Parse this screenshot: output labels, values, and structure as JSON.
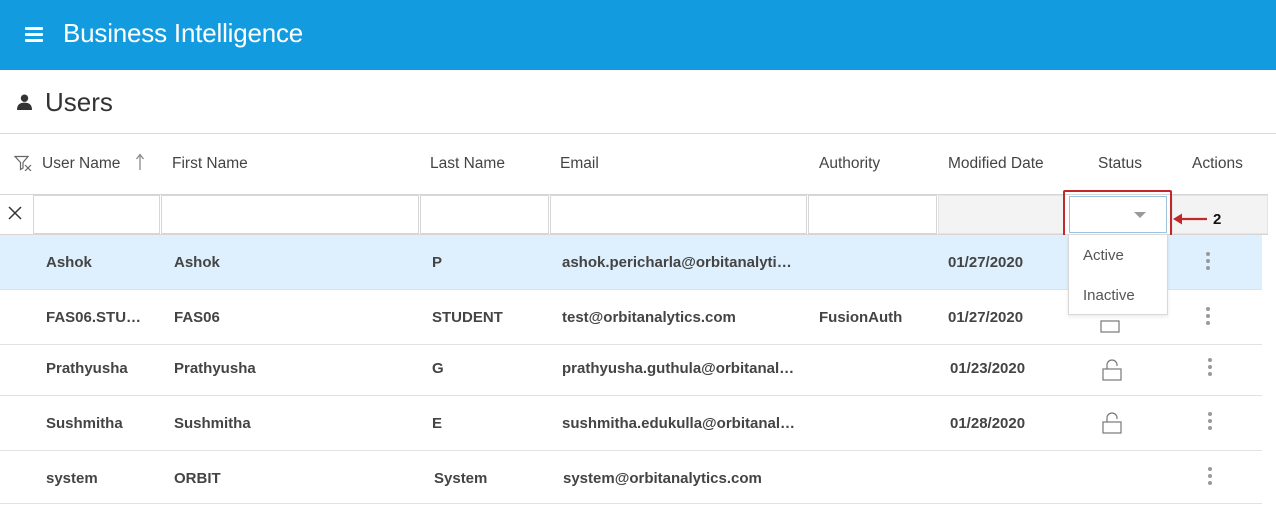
{
  "app": {
    "title": "Business Intelligence"
  },
  "page": {
    "title": "Users"
  },
  "columns": [
    "User Name",
    "First Name",
    "Last Name",
    "Email",
    "Authority",
    "Modified Date",
    "Status",
    "Actions"
  ],
  "status_filter": {
    "selected": "",
    "options": [
      "Active",
      "Inactive"
    ]
  },
  "annotation": {
    "step": "2",
    "color": "#c0282c"
  },
  "rows": [
    {
      "user_name": "Ashok",
      "first_name": "Ashok",
      "last_name": "P",
      "email": "ashok.pericharla@orbitanalyti…",
      "authority": "",
      "modified_date": "01/27/2020",
      "locked_icon": false
    },
    {
      "user_name": "FAS06.STU…",
      "first_name": "FAS06",
      "last_name": "STUDENT",
      "email": "test@orbitanalytics.com",
      "authority": "FusionAuth",
      "modified_date": "01/27/2020",
      "locked_icon": true
    },
    {
      "user_name": "Prathyusha",
      "first_name": "Prathyusha",
      "last_name": "G",
      "email": "prathyusha.guthula@orbitanal…",
      "authority": "",
      "modified_date": "01/23/2020",
      "locked_icon": true
    },
    {
      "user_name": "Sushmitha",
      "first_name": "Sushmitha",
      "last_name": "E",
      "email": "sushmitha.edukulla@orbitanal…",
      "authority": "",
      "modified_date": "01/28/2020",
      "locked_icon": true
    },
    {
      "user_name": "system",
      "first_name": "ORBIT",
      "last_name": "System",
      "email": "system@orbitanalytics.com",
      "authority": "",
      "modified_date": "",
      "locked_icon": false
    }
  ],
  "colors": {
    "header_bar": "#139be0",
    "selected_row": "#def0fd"
  }
}
